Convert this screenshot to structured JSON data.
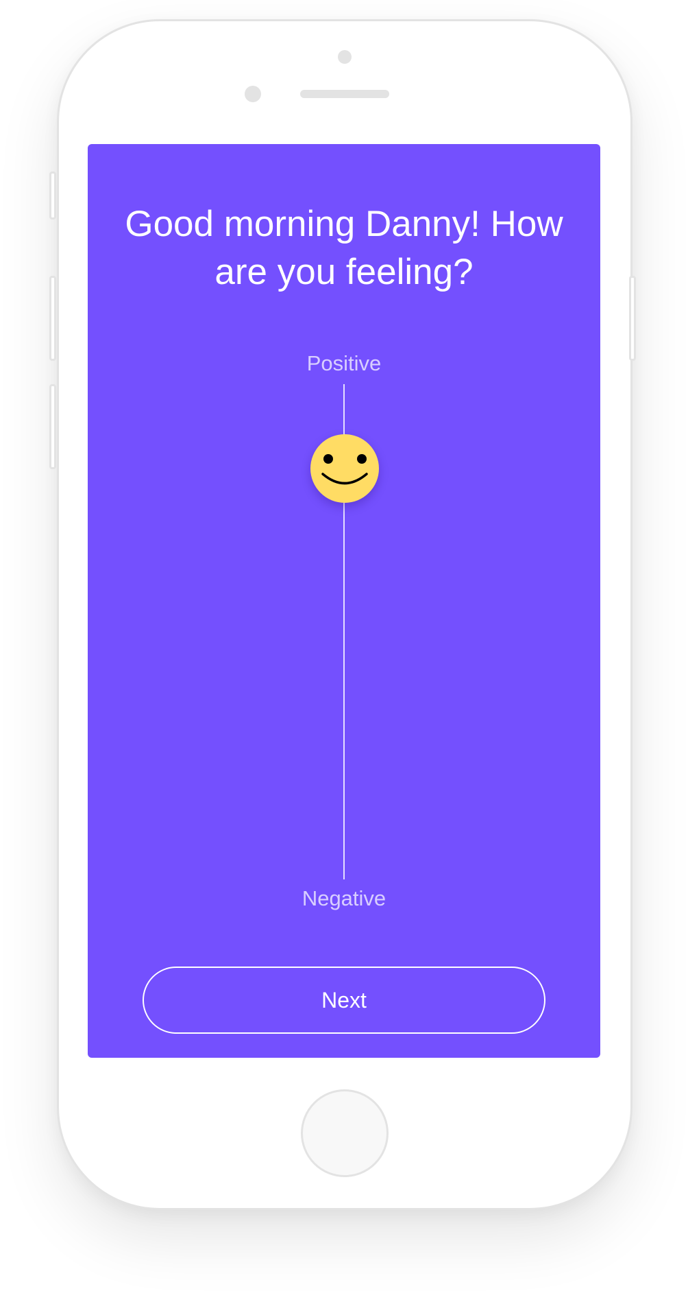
{
  "screen": {
    "background_color": "#7450fe",
    "greeting": "Good morning Danny! How are you feeling?"
  },
  "mood_scale": {
    "top_label": "Positive",
    "bottom_label": "Negative",
    "value_fraction_from_negative": 0.83,
    "thumb_icon": "smiley-face-icon",
    "thumb_color": "#ffdc64"
  },
  "actions": {
    "next_label": "Next"
  }
}
